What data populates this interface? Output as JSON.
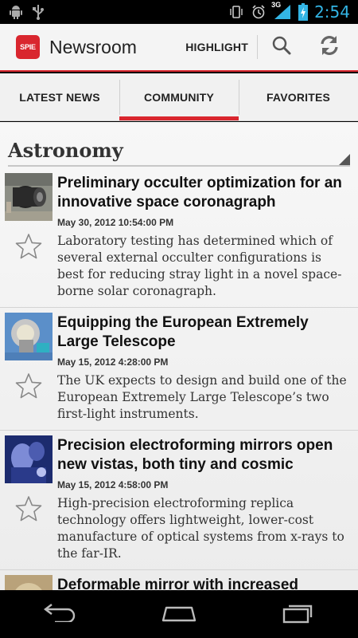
{
  "status_bar": {
    "time": "2:54",
    "network_label": "3G",
    "left_icons": [
      "android-icon",
      "usb-icon"
    ],
    "right_icons": [
      "vibrate-icon",
      "alarm-icon",
      "signal-icon",
      "battery-icon"
    ]
  },
  "action_bar": {
    "logo_text": "SPIE",
    "title": "Newsroom",
    "highlight_label": "HIGHLIGHT",
    "icons": [
      "search-icon",
      "refresh-icon"
    ],
    "accent_color": "#d9262e"
  },
  "tabs": [
    {
      "label": "LATEST NEWS",
      "active": false
    },
    {
      "label": "COMMUNITY",
      "active": true
    },
    {
      "label": "FAVORITES",
      "active": false
    }
  ],
  "section": {
    "title": "Astronomy"
  },
  "articles": [
    {
      "title": "Preliminary occulter optimization for an innovative space coronagraph",
      "date": "May 30, 2012 10:54:00 PM",
      "summary": "Laboratory testing has determined which of several external occulter configurations is best for reducing stray light in a novel space-borne solar coronagraph.",
      "favorite": false
    },
    {
      "title": "Equipping the European Extremely Large Telescope",
      "date": "May 15, 2012 4:28:00 PM",
      "summary": "The UK expects to design and build one of the European Extremely Large Telescope’s two first-light instruments.",
      "favorite": false
    },
    {
      "title": "Precision electroforming mirrors open new vistas, both tiny and cosmic",
      "date": "May 15, 2012 4:58:00 PM",
      "summary": "High-precision electroforming replica technology offers lightweight, lower-cost manufacture of optical systems from x-rays to the far-IR.",
      "favorite": false
    },
    {
      "title": "Deformable mirror with increased",
      "date": "",
      "summary": "",
      "favorite": false
    }
  ],
  "nav_bar": {
    "icons": [
      "back-icon",
      "home-icon",
      "recent-apps-icon"
    ]
  }
}
